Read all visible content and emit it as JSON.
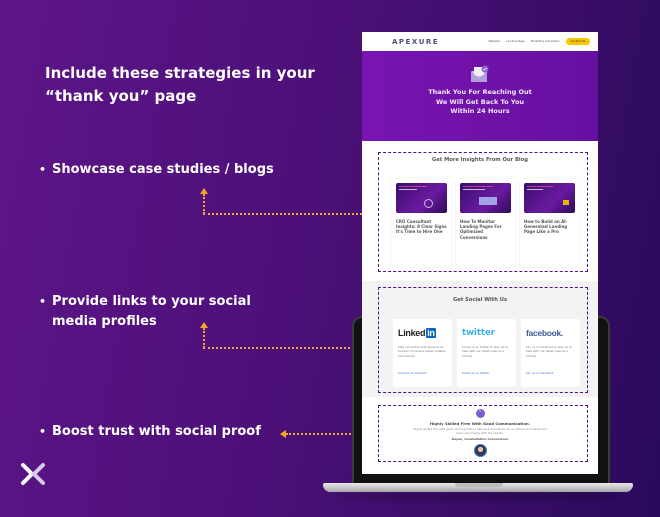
{
  "infographic": {
    "headline": "Include these strategies in your “thank you” page",
    "bullets": [
      "Showcase case studies / blogs",
      "Provide links to your social media profiles",
      "Boost trust with social proof"
    ],
    "brand_logo_icon": "apexure-x-logo-icon",
    "colors": {
      "background": "#4c1078",
      "connector": "#f6a623",
      "dashed_outline": "#4a1580"
    }
  },
  "site": {
    "nav": {
      "brand": "APEXURE",
      "links": [
        "Websites",
        "Landing Pages",
        "Marketing Automation"
      ],
      "cta": "Contact Us"
    },
    "hero": {
      "icon": "envelope-check-icon",
      "lines": [
        "Thank You For Reaching Out",
        "We Will Get Back To You",
        "Within 24 Hours"
      ]
    },
    "blog": {
      "title": "Get More Insights From Our Blog",
      "posts": [
        {
          "title": "CRO Consultant Insights: 8 Clear Signs It's Time to Hire One"
        },
        {
          "title": "How To Monitor Landing Pages For Optimized Conversions"
        },
        {
          "title": "How to Build an AI-Generated Landing Page Like a Pro"
        }
      ]
    },
    "social": {
      "title": "Get Social With Us",
      "cards": [
        {
          "network": "Linked",
          "network_suffix": "in",
          "desc": "Stay connected with Apexure on LinkedIn to receive latest updates and articles.",
          "link": "Connect on LinkedIn"
        },
        {
          "network": "twitter",
          "desc": "Follow us on twitter to stay up to date with our latest news and articles.",
          "link": "Follow us on Twitter"
        },
        {
          "network": "facebook.",
          "desc": "Join us on facebook to stay up to date with our latest news and articles.",
          "link": "Join us on Facebook"
        }
      ]
    },
    "testimonial": {
      "icon": "quote-icon",
      "quote_glyph": "“",
      "title": "Highly Skilled Firm With Good Communication.",
      "text": "Highly skilled firm with good communication. We have hired them for a number of projects and been very happy with the results.",
      "author": "Rayan, Constellation Conversions"
    }
  }
}
